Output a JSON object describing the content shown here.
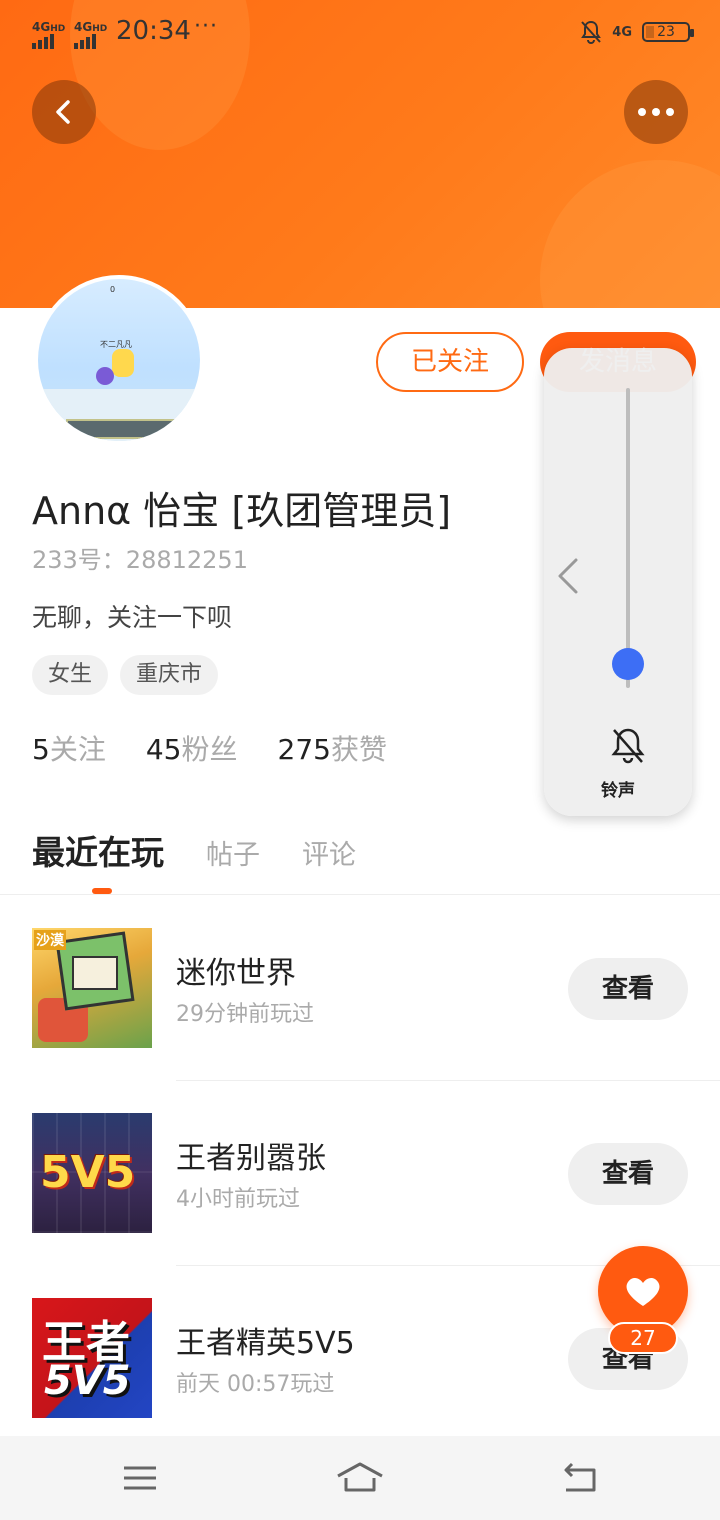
{
  "status_bar": {
    "signal1": "4G",
    "signal2": "4G",
    "hd1": "HD",
    "hd2": "HD",
    "time": "20:34",
    "more": "···",
    "network_right": "4G",
    "battery": "23"
  },
  "profile": {
    "follow_button": "已关注",
    "message_button": "发消息",
    "name": "Annα  怡宝 [玖团管理员]",
    "uid": "233号：28812251",
    "bio": "无聊，关注一下呗",
    "tags": [
      "女生",
      "重庆市"
    ],
    "stats": [
      {
        "num": "5",
        "label": "关注"
      },
      {
        "num": "45",
        "label": "粉丝"
      },
      {
        "num": "275",
        "label": "获赞"
      }
    ]
  },
  "tabs": [
    "最近在玩",
    "帖子",
    "评论"
  ],
  "games": [
    {
      "title": "迷你世界",
      "sub": "29分钟前玩过",
      "button": "查看",
      "thumb_text": "沙漠"
    },
    {
      "title": "王者别嚣张",
      "sub": "4小时前玩过",
      "button": "查看",
      "thumb_text": "5V5"
    },
    {
      "title": "王者精英5V5",
      "sub": "前天 00:57玩过",
      "button": "查看",
      "thumb_text1": "王者",
      "thumb_text2": "5V5"
    }
  ],
  "volume_panel": {
    "label": "铃声",
    "level": 0.08
  },
  "like": {
    "count": "27"
  },
  "avatar_text": {
    "top": "0",
    "tag": "不二凡凡"
  },
  "colors": {
    "accent": "#ff5a10",
    "banner": "#ff7a1a",
    "volume_knob": "#3d6ef5"
  }
}
